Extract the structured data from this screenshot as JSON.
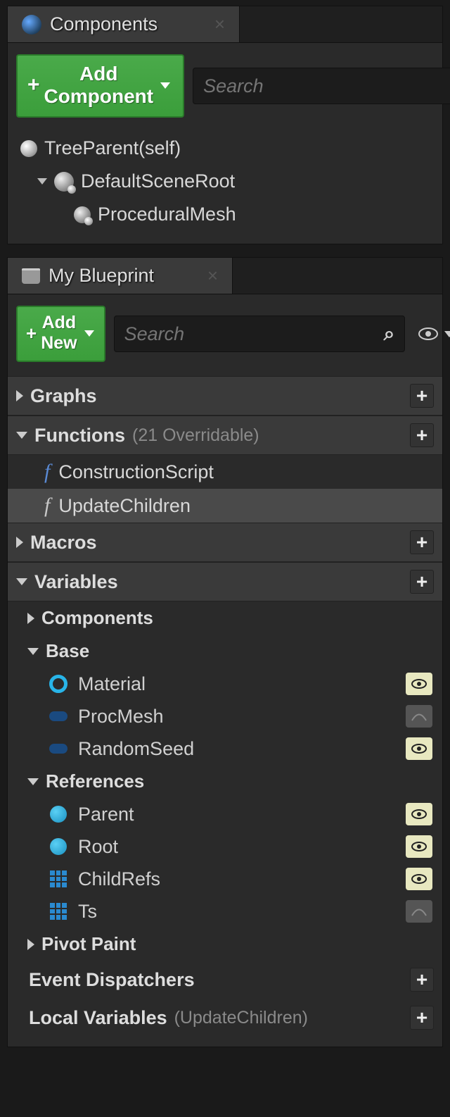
{
  "components_panel": {
    "title": "Components",
    "add_button": "Add Component",
    "search_placeholder": "Search",
    "tree": {
      "root": "TreeParent(self)",
      "scene": "DefaultSceneRoot",
      "child": "ProceduralMesh"
    }
  },
  "blueprint_panel": {
    "title": "My Blueprint",
    "add_button": "Add New",
    "search_placeholder": "Search",
    "sections": {
      "graphs": {
        "label": "Graphs"
      },
      "functions": {
        "label": "Functions",
        "meta": "(21 Overridable)",
        "items": [
          "ConstructionScript",
          "UpdateChildren"
        ]
      },
      "macros": {
        "label": "Macros"
      },
      "variables": {
        "label": "Variables",
        "groups": {
          "components": "Components",
          "base": {
            "label": "Base",
            "items": [
              "Material",
              "ProcMesh",
              "RandomSeed"
            ]
          },
          "references": {
            "label": "References",
            "items": [
              "Parent",
              "Root",
              "ChildRefs",
              "Ts"
            ]
          },
          "pivot": "Pivot Paint"
        }
      },
      "dispatchers": {
        "label": "Event Dispatchers"
      },
      "locals": {
        "label": "Local Variables",
        "meta": "(UpdateChildren)"
      }
    }
  }
}
